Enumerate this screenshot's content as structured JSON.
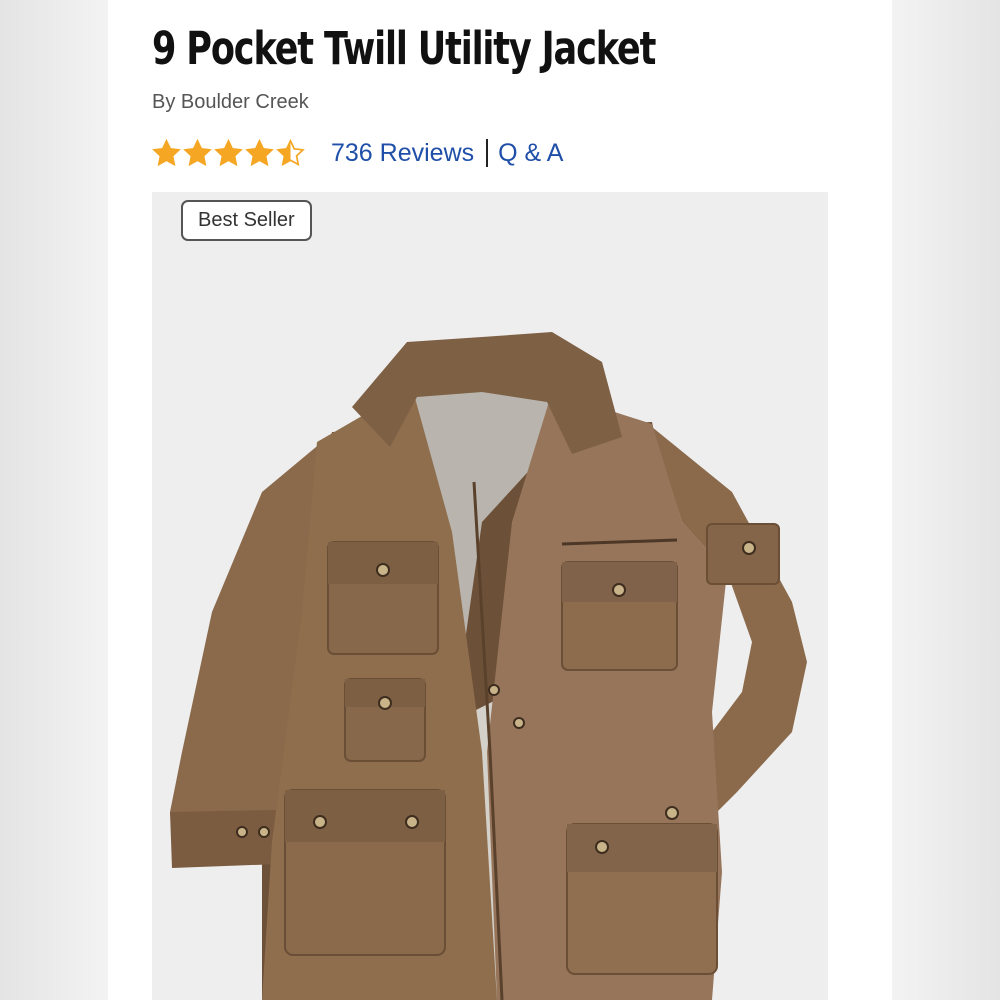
{
  "product": {
    "title": "9 Pocket Twill Utility Jacket",
    "brand": "By Boulder Creek",
    "rating": 4.5,
    "rating_max": 5,
    "reviews_label": "736 Reviews",
    "qa_label": "Q & A",
    "badge": "Best Seller"
  },
  "colors": {
    "star": "#f5a623",
    "link": "#1f4fa8",
    "jacket": "#8a6a4b"
  },
  "icons": {
    "rating": "star-icon"
  }
}
